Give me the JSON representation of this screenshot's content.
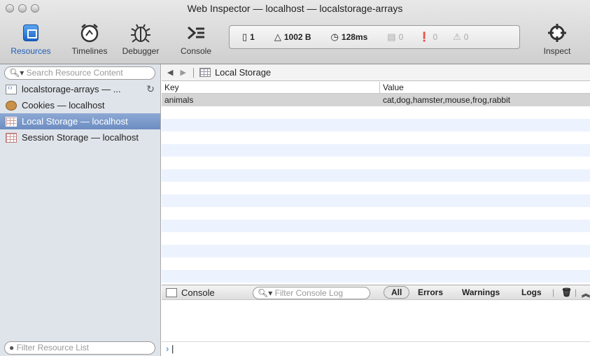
{
  "window": {
    "title": "Web Inspector — localhost — localstorage-arrays"
  },
  "toolbar": {
    "tabs": [
      {
        "label": "Resources",
        "icon": "resources-icon"
      },
      {
        "label": "Timelines",
        "icon": "timelines-icon"
      },
      {
        "label": "Debugger",
        "icon": "debugger-icon"
      },
      {
        "label": "Console",
        "icon": "console-icon"
      }
    ],
    "inspect_label": "Inspect"
  },
  "dashboard": {
    "resources": "1",
    "size": "1002 B",
    "time": "128ms",
    "logs": "0",
    "errors": "0",
    "warnings": "0"
  },
  "sidebar": {
    "search_placeholder": "Search Resource Content",
    "filter_placeholder": "Filter Resource List",
    "items": [
      {
        "label": "localstorage-arrays — ...",
        "icon": "document-icon"
      },
      {
        "label": "Cookies — localhost",
        "icon": "cookie-icon"
      },
      {
        "label": "Local Storage — localhost",
        "icon": "storage-grid-icon"
      },
      {
        "label": "Session Storage — localhost",
        "icon": "storage-grid-icon"
      }
    ]
  },
  "content": {
    "breadcrumb": "Local Storage",
    "columns": [
      "Key",
      "Value"
    ],
    "rows": [
      {
        "key": "animals",
        "value": "cat,dog,hamster,mouse,frog,rabbit"
      }
    ]
  },
  "console": {
    "label": "Console",
    "filter_placeholder": "Filter Console Log",
    "buttons": [
      "All",
      "Errors",
      "Warnings",
      "Logs"
    ],
    "prompt": "›"
  }
}
